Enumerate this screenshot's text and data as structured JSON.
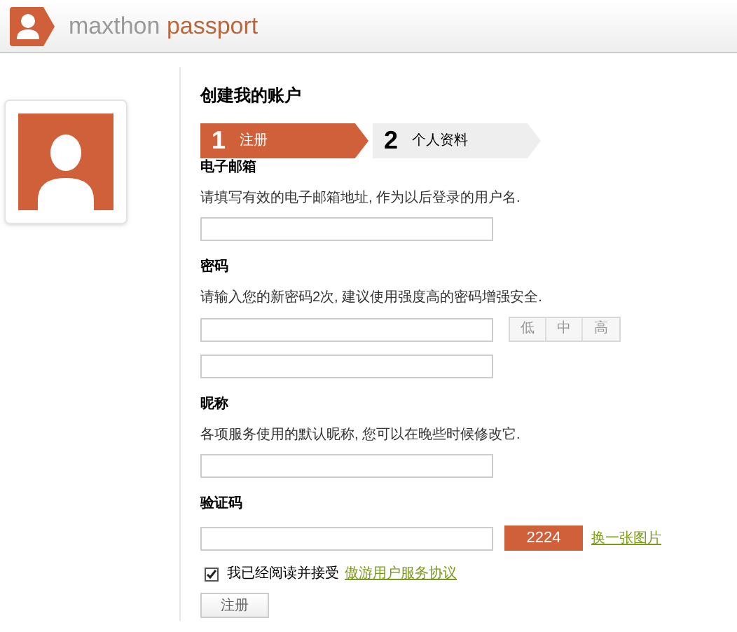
{
  "header": {
    "logo_text": "maxthon",
    "logo_accent": "passport"
  },
  "title": "创建我的账户",
  "steps": [
    {
      "number": "1",
      "label": "注册",
      "selected": true
    },
    {
      "number": "2",
      "label": "个人资料",
      "selected": false
    }
  ],
  "email": {
    "label": "电子邮箱",
    "hint": "请填写有效的电子邮箱地址, 作为以后登录的用户名."
  },
  "password": {
    "label": "密码",
    "hint": "请输入您的新密码2次, 建议使用强度高的密码增强安全.",
    "strength": [
      "低",
      "中",
      "高"
    ]
  },
  "nickname": {
    "label": "昵称",
    "hint": "各项服务使用的默认昵称, 您可以在晚些时候修改它."
  },
  "captcha": {
    "label": "验证码",
    "code": "2224",
    "refresh_link": "换一张图片"
  },
  "agreement": {
    "checked": true,
    "text": "我已经阅读并接受",
    "link": "傲游用户服务协议"
  },
  "submit": "注册"
}
